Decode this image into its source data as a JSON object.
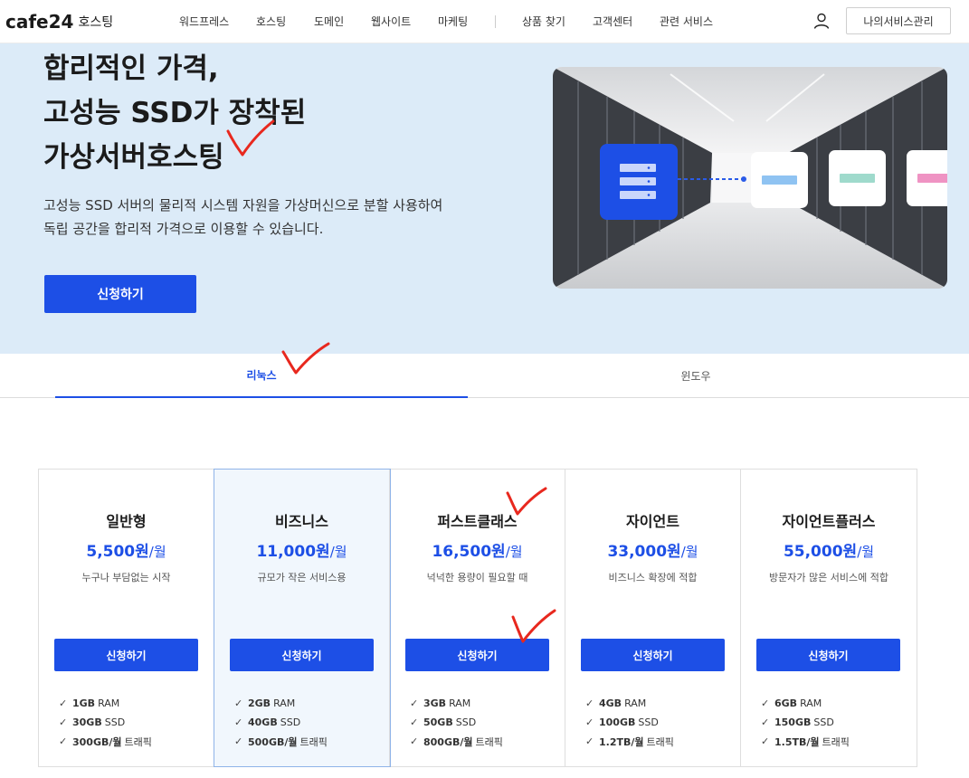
{
  "header": {
    "logo_mark": "cafe24",
    "logo_sub": "호스팅",
    "nav": [
      "워드프레스",
      "호스팅",
      "도메인",
      "웹사이트",
      "마케팅",
      "상품 찾기",
      "고객센터",
      "관련 서비스"
    ],
    "my_service": "나의서비스관리",
    "user_icon": "user-icon"
  },
  "hero": {
    "title_lines": [
      "합리적인 가격,",
      "고성능 SSD가 장착된",
      "가상서버호스팅"
    ],
    "desc_lines": [
      "고성능 SSD 서버의 물리적 시스템 자원을 가상머신으로 분할 사용하여",
      "독립 공간을 합리적 가격으로 이용할 수 있습니다."
    ],
    "cta": "신청하기"
  },
  "tabs": {
    "linux": "리눅스",
    "windows": "윈도우",
    "active": "linux"
  },
  "plans": [
    {
      "name": "일반형",
      "price": "5,500원",
      "unit": "/월",
      "desc": "누구나 부담없는 시작",
      "cta": "신청하기",
      "specs": [
        {
          "strong": "1GB",
          "rest": "RAM"
        },
        {
          "strong": "30GB",
          "rest": "SSD"
        },
        {
          "strong": "300GB/월",
          "rest": "트래픽"
        }
      ]
    },
    {
      "name": "비즈니스",
      "price": "11,000원",
      "unit": "/월",
      "desc": "규모가 작은 서비스용",
      "cta": "신청하기",
      "specs": [
        {
          "strong": "2GB",
          "rest": "RAM"
        },
        {
          "strong": "40GB",
          "rest": "SSD"
        },
        {
          "strong": "500GB/월",
          "rest": "트래픽"
        }
      ]
    },
    {
      "name": "퍼스트클래스",
      "price": "16,500원",
      "unit": "/월",
      "desc": "넉넉한 용량이 필요할 때",
      "cta": "신청하기",
      "specs": [
        {
          "strong": "3GB",
          "rest": "RAM"
        },
        {
          "strong": "50GB",
          "rest": "SSD"
        },
        {
          "strong": "800GB/월",
          "rest": "트래픽"
        }
      ]
    },
    {
      "name": "자이언트",
      "price": "33,000원",
      "unit": "/월",
      "desc": "비즈니스 확장에 적합",
      "cta": "신청하기",
      "specs": [
        {
          "strong": "4GB",
          "rest": "RAM"
        },
        {
          "strong": "100GB",
          "rest": "SSD"
        },
        {
          "strong": "1.2TB/월",
          "rest": "트래픽"
        }
      ]
    },
    {
      "name": "자이언트플러스",
      "price": "55,000원",
      "unit": "/월",
      "desc": "방문자가 많은 서비스에 적합",
      "cta": "신청하기",
      "specs": [
        {
          "strong": "6GB",
          "rest": "RAM"
        },
        {
          "strong": "150GB",
          "rest": "SSD"
        },
        {
          "strong": "1.5TB/월",
          "rest": "트래픽"
        }
      ]
    }
  ],
  "colors": {
    "accent": "#1d4fe6",
    "hero_bg": "#dcebf8",
    "annotation": "#e8281e"
  },
  "icons": {
    "check": "check-icon",
    "server": "server-icon"
  }
}
